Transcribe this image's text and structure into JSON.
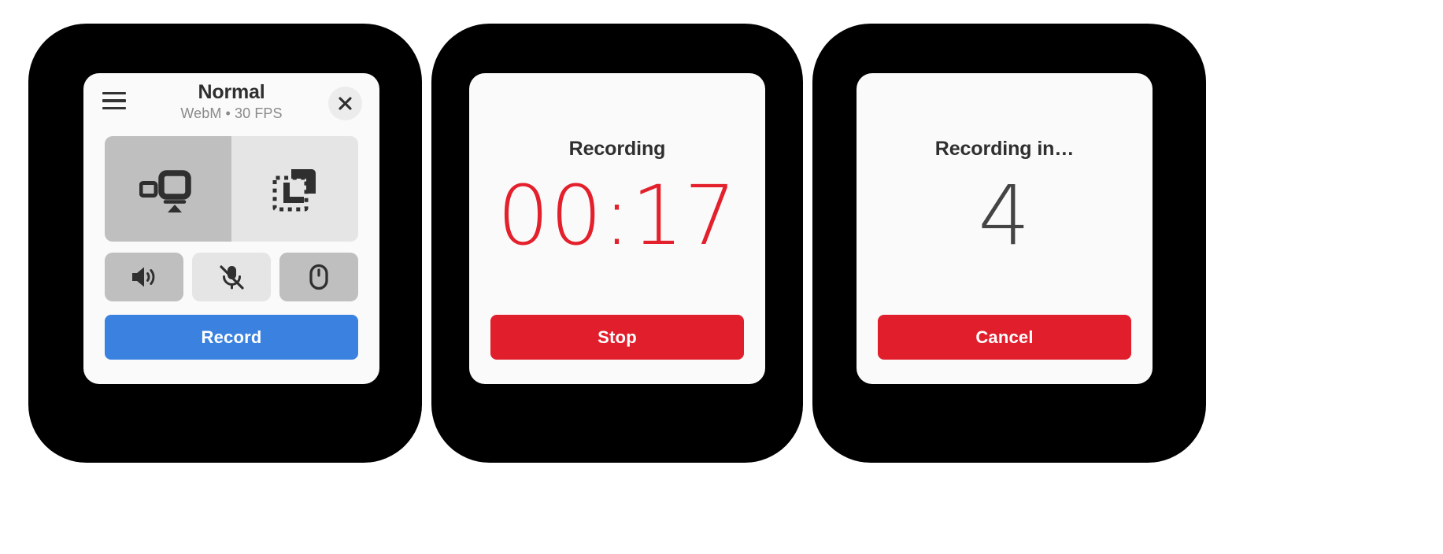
{
  "theme": {
    "accent_blue": "#3B82E0",
    "accent_red": "#E11F2C",
    "timer_red": "#E3202C",
    "card_bg": "#FAFAFA",
    "backdrop": "#000000",
    "toggle_on_bg": "#BFBFBF",
    "toggle_off_bg": "#E5E5E5"
  },
  "panel_settings": {
    "menu_icon": "hamburger-menu-icon",
    "title": "Normal",
    "subtitle": "WebM • 30 FPS",
    "close_icon": "close-x-icon",
    "modes": [
      {
        "name": "fullscreen-capture",
        "icon": "screen-share-icon",
        "selected": true
      },
      {
        "name": "region-capture",
        "icon": "crop-region-icon",
        "selected": false
      }
    ],
    "toggles": [
      {
        "name": "system-audio",
        "icon": "speaker-on-icon",
        "enabled": true
      },
      {
        "name": "microphone",
        "icon": "microphone-muted-icon",
        "enabled": false
      },
      {
        "name": "mouse-cursor",
        "icon": "mouse-cursor-icon",
        "enabled": true
      }
    ],
    "record_label": "Record"
  },
  "panel_recording": {
    "heading": "Recording",
    "timer": "00:17",
    "stop_label": "Stop"
  },
  "panel_countdown": {
    "heading": "Recording in…",
    "count": "4",
    "cancel_label": "Cancel"
  }
}
